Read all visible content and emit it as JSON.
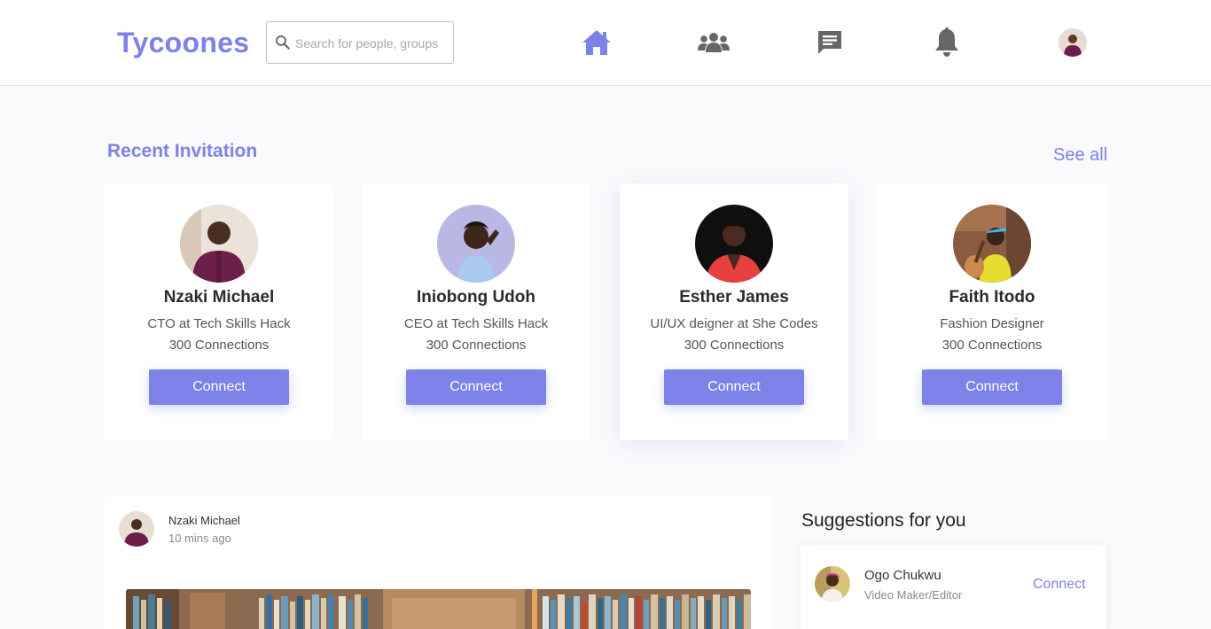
{
  "brand": {
    "name": "Tycoones",
    "accent_color": "#7d82e8"
  },
  "search": {
    "placeholder": "Search for people, groups",
    "value": ""
  },
  "nav": {
    "icons": [
      "home-icon",
      "groups-icon",
      "messages-icon",
      "notifications-icon",
      "profile-avatar"
    ],
    "active": "home-icon",
    "active_color": "#7d82e8",
    "inactive_color": "#666666"
  },
  "invitations": {
    "title": "Recent Invitation",
    "see_all": "See all",
    "cards": [
      {
        "name": "Nzaki Michael",
        "role": "CTO at Tech Skills Hack",
        "connections": "300 Connections",
        "button": "Connect"
      },
      {
        "name": "Iniobong Udoh",
        "role": "CEO at Tech Skills Hack",
        "connections": "300 Connections",
        "button": "Connect"
      },
      {
        "name": "Esther James",
        "role": "UI/UX deigner at She Codes",
        "connections": "300 Connections",
        "button": "Connect"
      },
      {
        "name": "Faith Itodo",
        "role": "Fashion Designer",
        "connections": "300 Connections",
        "button": "Connect"
      }
    ]
  },
  "post": {
    "author": "Nzaki Michael",
    "time": "10 mins ago"
  },
  "suggestions": {
    "title": "Suggestions for you",
    "items": [
      {
        "name": "Ogo Chukwu",
        "role": "Video Maker/Editor",
        "action": "Connect"
      }
    ]
  }
}
